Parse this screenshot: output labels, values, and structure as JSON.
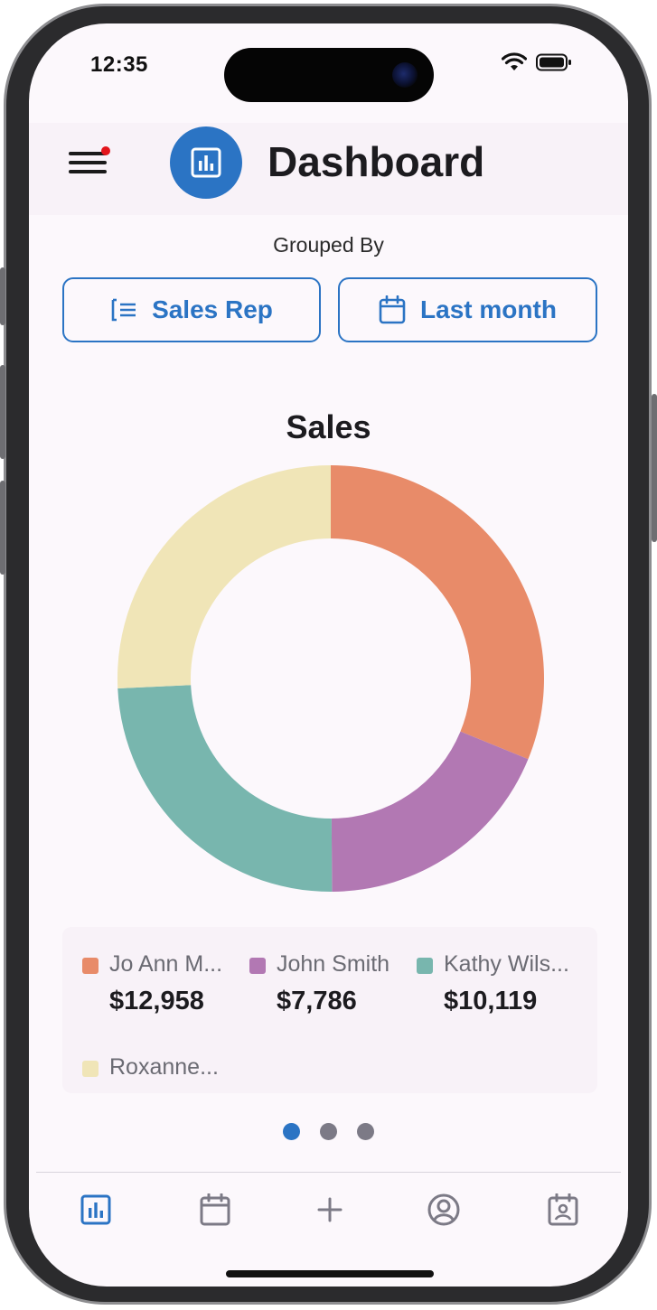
{
  "status_bar": {
    "time": "12:35"
  },
  "header": {
    "title": "Dashboard",
    "menu_icon": "hamburger-menu-icon",
    "logo_icon": "bar-chart-icon",
    "notification_dot_color": "#e3141b"
  },
  "filters": {
    "grouped_by_label": "Grouped By",
    "group_button": {
      "label": "Sales Rep",
      "icon": "list-icon"
    },
    "period_button": {
      "label": "Last month",
      "icon": "calendar-icon"
    }
  },
  "chart_data": {
    "type": "pie",
    "title": "Sales",
    "donut": true,
    "categories": [
      "Jo Ann M...",
      "John Smith",
      "Kathy Wils...",
      "Roxanne..."
    ],
    "values": [
      12958,
      7786,
      10119,
      10700
    ],
    "value_labels": [
      "$12,958",
      "$7,786",
      "$10,119",
      ""
    ],
    "colors": [
      "#e88b69",
      "#b278b3",
      "#78b6ae",
      "#f0e5b7"
    ],
    "legend_placement": "bottom"
  },
  "pager": {
    "pages": 3,
    "active_index": 0
  },
  "tabbar": {
    "tabs": [
      {
        "icon": "bar-chart-icon",
        "active": true
      },
      {
        "icon": "calendar-icon",
        "active": false
      },
      {
        "icon": "plus-icon",
        "active": false
      },
      {
        "icon": "account-icon",
        "active": false
      },
      {
        "icon": "contact-calendar-icon",
        "active": false
      }
    ]
  },
  "colors": {
    "accent": "#2b74c4",
    "background": "#fcf8fc",
    "inactive_icon": "#7c7a86"
  }
}
